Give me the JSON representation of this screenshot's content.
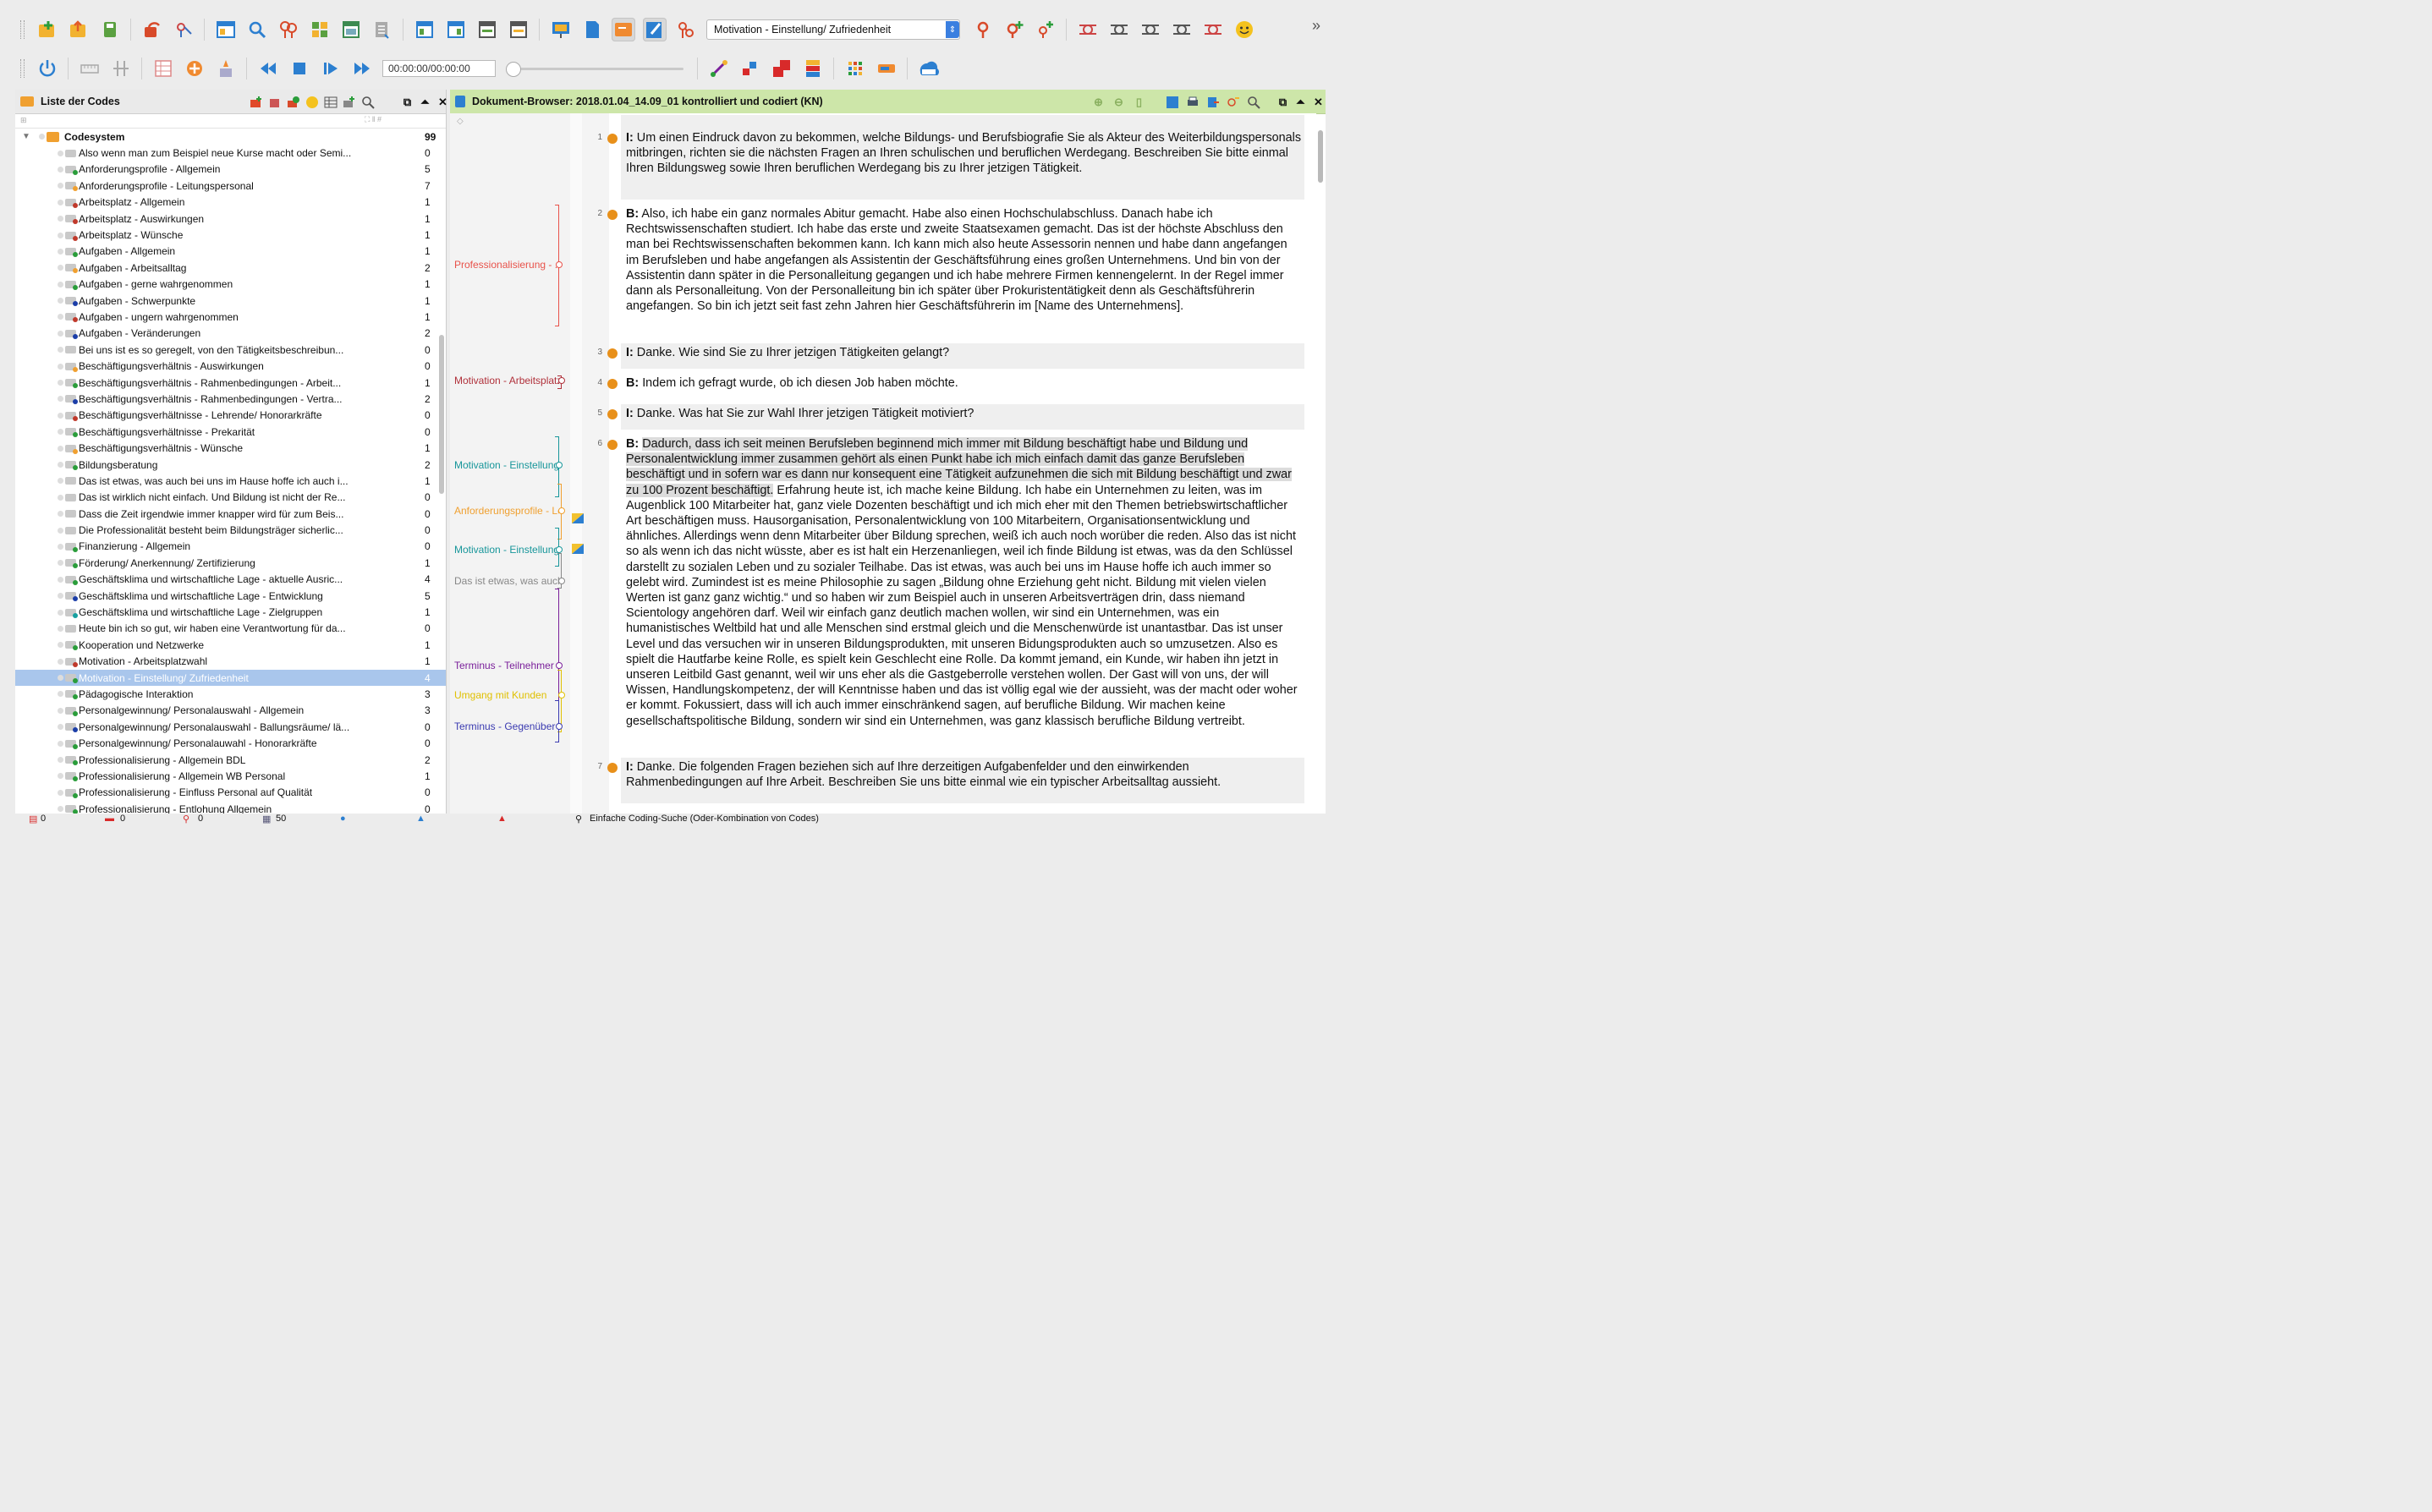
{
  "toolbar": {
    "code_combo_value": "Motivation - Einstellung/ Zufriedenheit",
    "media_time": "00:00:00/00:00:00",
    "more_label": "»"
  },
  "left_panel": {
    "title": "Liste der Codes",
    "subheader_symbols": "⛶ ‖ #"
  },
  "codes": [
    {
      "label": "Codesystem",
      "count": "99",
      "root": true
    },
    {
      "label": "Also wenn man zum Beispiel neue Kurse macht oder Semi...",
      "count": "0",
      "dot": ""
    },
    {
      "label": "Anforderungsprofile - Allgemein",
      "count": "5",
      "dot": "#2a9d3a"
    },
    {
      "label": "Anforderungsprofile - Leitungspersonal",
      "count": "7",
      "dot": "#f0a030"
    },
    {
      "label": "Arbeitsplatz - Allgemein",
      "count": "1",
      "dot": "#c0392b"
    },
    {
      "label": "Arbeitsplatz - Auswirkungen",
      "count": "1",
      "dot": "#c0392b"
    },
    {
      "label": "Arbeitsplatz - Wünsche",
      "count": "1",
      "dot": "#c0392b"
    },
    {
      "label": "Aufgaben - Allgemein",
      "count": "1",
      "dot": "#2a9d3a"
    },
    {
      "label": "Aufgaben - Arbeitsalltag",
      "count": "2",
      "dot": "#f0a030"
    },
    {
      "label": "Aufgaben - gerne wahrgenommen",
      "count": "1",
      "dot": "#2a9d3a"
    },
    {
      "label": "Aufgaben - Schwerpunkte",
      "count": "1",
      "dot": "#1b3ea8"
    },
    {
      "label": "Aufgaben - ungern wahrgenommen",
      "count": "1",
      "dot": "#c0392b"
    },
    {
      "label": "Aufgaben - Veränderungen",
      "count": "2",
      "dot": "#1b3ea8"
    },
    {
      "label": "Bei uns ist es so geregelt, von den Tätigkeitsbeschreibun...",
      "count": "0",
      "dot": ""
    },
    {
      "label": "Beschäftigungsverhältnis - Auswirkungen",
      "count": "0",
      "dot": "#f0a030"
    },
    {
      "label": "Beschäftigungsverhältnis - Rahmenbedingungen - Arbeit...",
      "count": "1",
      "dot": "#2a9d3a"
    },
    {
      "label": "Beschäftigungsverhältnis - Rahmenbedingungen - Vertra...",
      "count": "2",
      "dot": "#1b3ea8"
    },
    {
      "label": "Beschäftigungsverhältnisse - Lehrende/ Honorarkräfte",
      "count": "0",
      "dot": "#c0392b"
    },
    {
      "label": "Beschäftigungsverhältnisse - Prekarität",
      "count": "0",
      "dot": "#2a9d3a"
    },
    {
      "label": "Beschäftigungsverhältnis - Wünsche",
      "count": "1",
      "dot": "#f0a030"
    },
    {
      "label": "Bildungsberatung",
      "count": "2",
      "dot": "#2a9d3a"
    },
    {
      "label": "Das ist etwas, was auch bei uns im Hause hoffe ich auch i...",
      "count": "1",
      "dot": ""
    },
    {
      "label": "Das ist wirklich nicht einfach. Und Bildung ist nicht der Re...",
      "count": "0",
      "dot": ""
    },
    {
      "label": "Dass die Zeit irgendwie immer knapper wird für zum Beis...",
      "count": "0",
      "dot": ""
    },
    {
      "label": "Die Professionalität besteht beim Bildungsträger sicherlic...",
      "count": "0",
      "dot": ""
    },
    {
      "label": "Finanzierung - Allgemein",
      "count": "0",
      "dot": "#2a9d3a"
    },
    {
      "label": "Förderung/ Anerkennung/ Zertifizierung",
      "count": "1",
      "dot": "#2a9d3a"
    },
    {
      "label": "Geschäftsklima und wirtschaftliche Lage - aktuelle Ausric...",
      "count": "4",
      "dot": "#2a9d3a"
    },
    {
      "label": "Geschäftsklima und wirtschaftliche Lage - Entwicklung",
      "count": "5",
      "dot": "#1b3ea8"
    },
    {
      "label": "Geschäftsklima und wirtschaftliche Lage - Zielgruppen",
      "count": "1",
      "dot": "#16a0a0"
    },
    {
      "label": "Heute bin ich so gut, wir haben eine Verantwortung für da...",
      "count": "0",
      "dot": ""
    },
    {
      "label": "Kooperation und Netzwerke",
      "count": "1",
      "dot": "#2a9d3a"
    },
    {
      "label": "Motivation - Arbeitsplatzwahl",
      "count": "1",
      "dot": "#c0392b"
    },
    {
      "label": "Motivation - Einstellung/ Zufriedenheit",
      "count": "4",
      "dot": "#2a9d3a",
      "selected": true
    },
    {
      "label": "Pädagogische Interaktion",
      "count": "3",
      "dot": "#2a9d3a"
    },
    {
      "label": "Personalgewinnung/ Personalauswahl - Allgemein",
      "count": "3",
      "dot": "#2a9d3a"
    },
    {
      "label": "Personalgewinnung/ Personalauswahl - Ballungsräume/ lä...",
      "count": "0",
      "dot": "#1b3ea8"
    },
    {
      "label": "Personalgewinnung/ Personalauwahl - Honorarkräfte",
      "count": "0",
      "dot": "#2a9d3a"
    },
    {
      "label": "Professionalisierung - Allgemein BDL",
      "count": "2",
      "dot": "#2a9d3a"
    },
    {
      "label": "Professionalisierung - Allgemein WB Personal",
      "count": "1",
      "dot": "#2a9d3a"
    },
    {
      "label": "Professionalisierung - Einfluss Personal auf Qualität",
      "count": "0",
      "dot": "#2a9d3a"
    },
    {
      "label": "Professionalisierung - Entlohung Allgemein",
      "count": "0",
      "dot": "#2a9d3a"
    }
  ],
  "document": {
    "title": "Dokument-Browser: 2018.01.04_14.09_01 kontrolliert und codiert (KN)",
    "margin_header_symbol": "◇",
    "margin_codes": [
      {
        "label": "Professionalisierung - ...",
        "color": "#e8524a"
      },
      {
        "label": "Motivation - Arbeitsplatzwahl",
        "color": "#b0303a"
      },
      {
        "label": "Motivation - Einstellung/ Zufriedenheit",
        "color": "#17969a"
      },
      {
        "label": "Anforderungsprofile - Leitungspersonal",
        "color": "#f0a030"
      },
      {
        "label": "Motivation - Einstellung/ Zufriedenheit",
        "color": "#17969a"
      },
      {
        "label": "Das ist etwas, was auch ...",
        "color": "#888888"
      },
      {
        "label": "Terminus - Teilnehmer",
        "color": "#7a1f9a"
      },
      {
        "label": "Umgang mit Kunden",
        "color": "#e0c000"
      },
      {
        "label": "Terminus - Gegenüber",
        "color": "#3a3ab0"
      }
    ],
    "paragraphs": [
      {
        "n": "1",
        "speaker": "I:",
        "text": "Um einen Eindruck davon zu bekommen, welche Bildungs- und Berufsbiografie Sie als Akteur des Weiterbildungspersonals mitbringen, richten sie die nächsten Fragen an Ihren schulischen und beruflichen Werdegang. Beschreiben Sie bitte einmal Ihren Bildungsweg sowie Ihren beruflichen Werdegang bis zu Ihrer jetzigen Tätigkeit."
      },
      {
        "n": "2",
        "speaker": "B:",
        "text": "Also, ich habe ein ganz normales Abitur gemacht. Habe also einen Hochschulabschluss. Danach habe ich Rechtswissenschaften studiert. Ich habe das erste und zweite Staatsexamen gemacht. Das ist der höchste Abschluss den man bei Rechtswissenschaften bekommen kann. Ich kann mich also heute Assessorin nennen und habe dann angefangen im Berufsleben und habe angefangen als Assistentin der Geschäftsführung eines großen Unternehmens. Und bin von der Assistentin dann später in die Personalleitung gegangen und ich habe mehrere Firmen kennengelernt. In der Regel immer dann als Personalleitung. Von der Personalleitung bin ich später über Prokuristentätigkeit denn als Geschäftsführerin angefangen. So bin ich jetzt seit fast zehn Jahren hier Geschäftsführerin im [Name des Unternehmens]."
      },
      {
        "n": "3",
        "speaker": "I:",
        "text": "Danke. Wie sind Sie zu Ihrer jetzigen Tätigkeiten gelangt?"
      },
      {
        "n": "4",
        "speaker": "B:",
        "text": "Indem ich gefragt wurde, ob ich diesen Job haben möchte."
      },
      {
        "n": "5",
        "speaker": "I:",
        "text": "Danke. Was hat Sie zur Wahl Ihrer jetzigen Tätigkeit motiviert?"
      },
      {
        "n": "6",
        "speaker": "B:",
        "highlight": "Dadurch, dass ich seit meinen Berufsleben beginnend mich immer mit Bildung beschäftigt habe und Bildung und Personalentwicklung immer zusammen gehört als einen Punkt habe ich mich einfach damit das ganze Berufsleben beschäftigt und in sofern war es dann nur konsequent eine Tätigkeit aufzunehmen die sich mit Bildung beschäftigt und zwar zu 100 Prozent beschäftigt.",
        "text": " Erfahrung heute ist, ich mache keine Bildung. Ich habe ein Unternehmen zu leiten, was im Augenblick 100 Mitarbeiter hat, ganz viele Dozenten beschäftigt und ich mich eher mit den Themen betriebswirtschaftlicher Art beschäftigen muss. Hausorganisation, Personalentwicklung von 100 Mitarbeitern, Organisationsentwicklung und ähnliches. Allerdings wenn denn Mitarbeiter über Bildung sprechen, weiß ich auch noch worüber die reden. Also das ist nicht so als wenn ich das nicht wüsste, aber es ist halt ein Herzenanliegen, weil ich finde Bildung ist etwas, was da den Schlüssel darstellt zu sozialen Leben und zu sozialer Teilhabe. Das ist etwas, was auch bei uns im Hause hoffe ich auch immer so gelebt wird. Zumindest ist es meine Philosophie zu sagen „Bildung ohne Erziehung geht nicht. Bildung mit vielen vielen Werten ist ganz ganz wichtig.“ und so haben wir zum Beispiel auch in unseren Arbeitsverträgen drin, dass niemand Scientology angehören darf. Weil wir einfach ganz deutlich machen wollen, wir sind ein Unternehmen, was ein humanistisches Weltbild hat und alle Menschen sind erstmal gleich und die Menschenwürde ist unantastbar. Das ist unser Level und das versuchen wir in unseren Bildungsprodukten, mit unseren Bidungsprodukten auch so umzusetzen. Also es spielt die Hautfarbe keine Rolle, es spielt kein Geschlecht eine Rolle. Da kommt jemand, ein Kunde, wir haben ihn jetzt in unseren Leitbild Gast genannt, weil wir uns eher als die Gastgeberrolle verstehen wollen. Der Gast will von uns, der will Wissen, Handlungskompetenz, der will Kenntnisse haben und das ist völlig egal wie der aussieht, was der macht oder woher er kommt. Fokussiert, dass will ich auch immer einschränkend sagen, auf berufliche Bildung. Wir machen keine gesellschaftspolitische Bildung, sondern wir sind ein Unternehmen, was ganz klassisch berufliche Bildung vertreibt."
      },
      {
        "n": "7",
        "speaker": "I:",
        "text": "Danke. Die folgenden Fragen beziehen sich auf Ihre derzeitigen Aufgabenfelder und den einwirkenden Rahmenbedingungen auf Ihre Arbeit. Beschreiben Sie uns bitte einmal wie ein typischer Arbeitsalltag aussieht."
      }
    ]
  },
  "statusbar": {
    "c1": "0",
    "c2": "0",
    "c3": "0",
    "c4": "50",
    "search_mode": "Einfache Coding-Suche (Oder-Kombination von Codes)"
  }
}
